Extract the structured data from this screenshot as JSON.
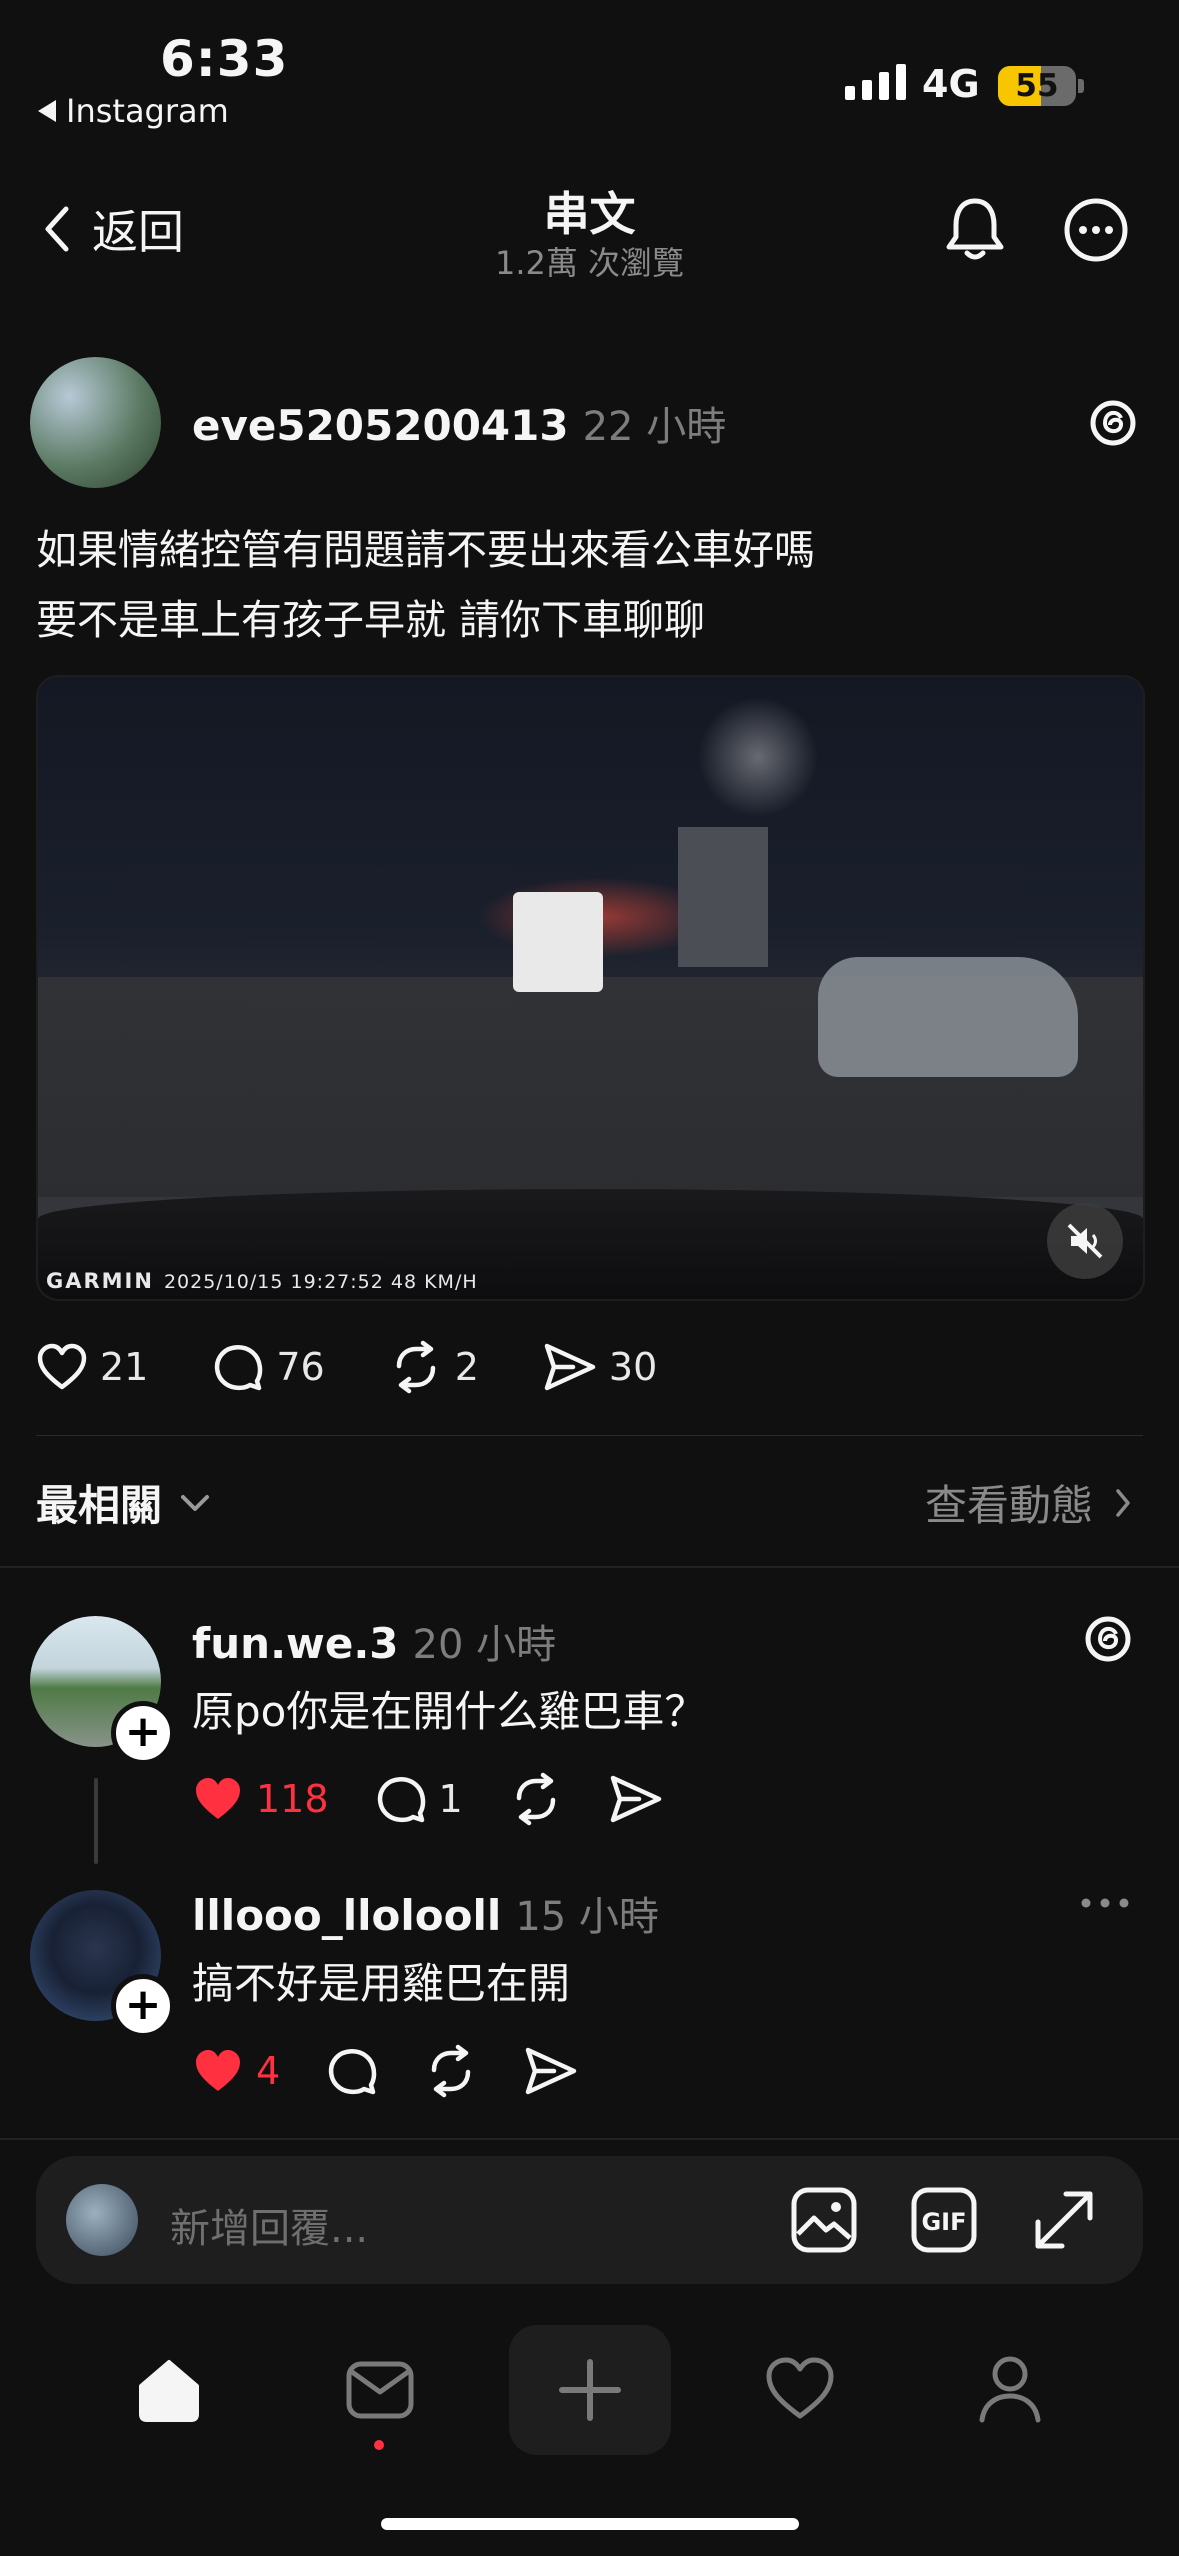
{
  "status_bar": {
    "time": "6:33",
    "back_app": "Instagram",
    "network": "4G",
    "battery": "55",
    "battery_level": 0.55
  },
  "header": {
    "back_label": "返回",
    "title": "串文",
    "views": "1.2萬 次瀏覽"
  },
  "post": {
    "username": "eve5205200413",
    "time": "22 小時",
    "lines": [
      "如果情緒控管有問題請不要出來看公車好嗎",
      "要不是車上有孩子早就 請你下車聊聊"
    ],
    "media_overlay": {
      "brand": "GARMIN",
      "stamp": "2025/10/15 19:27:52 48 KM/H"
    },
    "likes": "21",
    "comments": "76",
    "reposts": "2",
    "shares": "30"
  },
  "sort": {
    "label": "最相關",
    "activity": "查看動態"
  },
  "comments": [
    {
      "username": "fun.we.3",
      "time": "20 小時",
      "text": "原po你是在開什么雞巴車？",
      "likes": "118",
      "replies": "1"
    },
    {
      "username": "lllooo_llolooll",
      "time": "15 小時",
      "text": "搞不好是用雞巴在開",
      "likes": "4",
      "replies": ""
    }
  ],
  "reply": {
    "placeholder": "新增回覆..."
  },
  "colors": {
    "background": "#101010",
    "like_red": "#ff3040",
    "muted": "#8a8a8a",
    "battery_yellow": "#f7c600"
  },
  "icons": [
    "chevron-left-icon",
    "bell-icon",
    "more-icon",
    "threads-icon",
    "heart-icon",
    "comment-icon",
    "repost-icon",
    "share-icon",
    "mute-icon",
    "image-icon",
    "gif-icon",
    "expand-icon",
    "home-icon",
    "inbox-icon",
    "plus-icon",
    "profile-icon"
  ]
}
